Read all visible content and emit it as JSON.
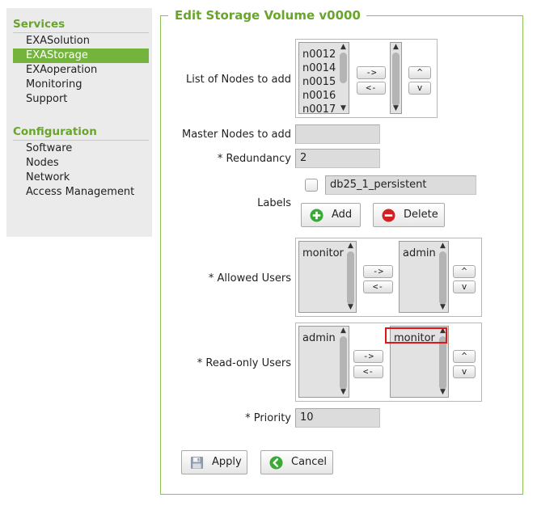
{
  "sidebar": {
    "services_title": "Services",
    "services_items": [
      {
        "label": "EXASolution"
      },
      {
        "label": "EXAStorage"
      },
      {
        "label": "EXAoperation"
      },
      {
        "label": "Monitoring"
      },
      {
        "label": "Support"
      }
    ],
    "active_item": "EXAStorage",
    "configuration_title": "Configuration",
    "configuration_items": [
      {
        "label": "Software"
      },
      {
        "label": "Nodes"
      },
      {
        "label": "Network"
      },
      {
        "label": "Access Management"
      }
    ]
  },
  "form": {
    "title": "Edit Storage Volume v0000",
    "nodes_label": "List of Nodes to add",
    "nodes_available": [
      "n0012",
      "n0014",
      "n0015",
      "n0016",
      "n0017"
    ],
    "nodes_selected": [],
    "master_nodes_label": "Master Nodes to add",
    "master_nodes_value": "",
    "redundancy_label": "* Redundancy",
    "redundancy_value": "2",
    "labels_label": "Labels",
    "label_value": "db25_1_persistent",
    "label_checked": false,
    "add_label": "Add",
    "delete_label": "Delete",
    "allowed_users_label": "* Allowed Users",
    "allowed_available": [
      "monitor"
    ],
    "allowed_selected": [
      "admin"
    ],
    "readonly_users_label": "* Read-only Users",
    "readonly_available": [
      "admin"
    ],
    "readonly_selected": [
      "monitor"
    ],
    "priority_label": "* Priority",
    "priority_value": "10",
    "move_right": "->",
    "move_left": "<-",
    "move_up": "^",
    "move_down": "v",
    "apply_label": "Apply",
    "cancel_label": "Cancel"
  },
  "icons": {
    "scroll_up": "▲",
    "scroll_down": "▼",
    "add": "add-icon",
    "delete": "delete-icon",
    "apply": "floppy-icon",
    "cancel": "back-arrow-icon"
  },
  "colors": {
    "accent_green": "#75b43c",
    "title_green": "#69a52c",
    "add_icon": "#3aa935",
    "delete_icon": "#d42020",
    "cancel_icon": "#3aa935",
    "highlight_red": "#e11717"
  }
}
